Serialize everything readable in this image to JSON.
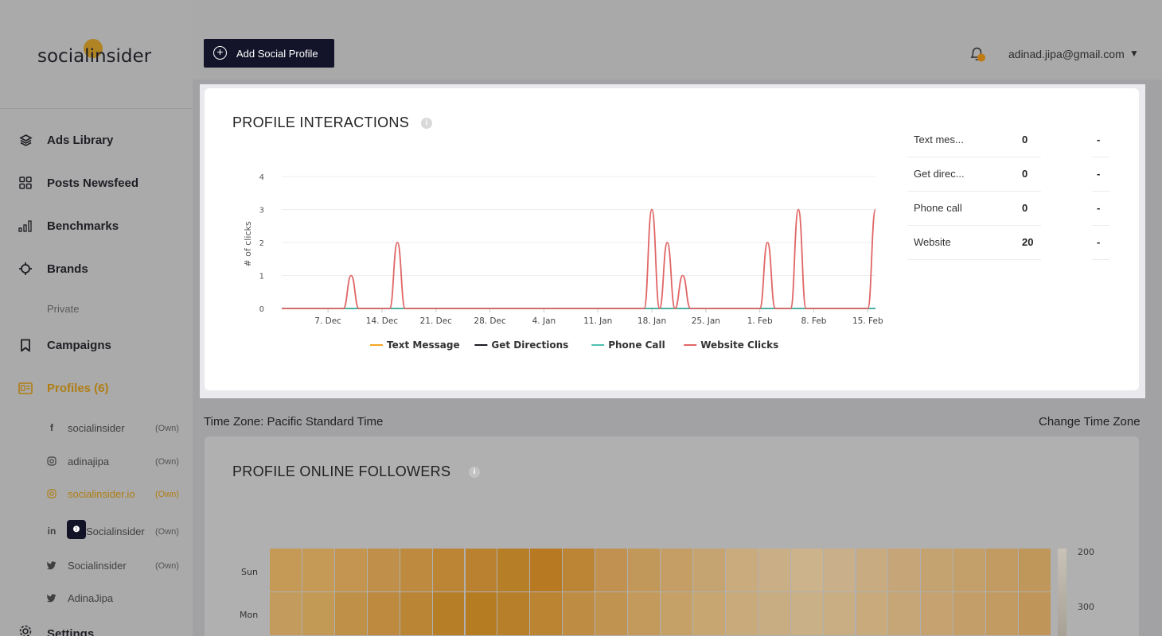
{
  "app": {
    "logo_text": "socialinsider"
  },
  "sidebar": {
    "items": [
      {
        "label": "Ads Library",
        "icon": "layers-icon"
      },
      {
        "label": "Posts Newsfeed",
        "icon": "grid-icon"
      },
      {
        "label": "Benchmarks",
        "icon": "bar-chart-icon"
      },
      {
        "label": "Brands",
        "icon": "crosshair-icon"
      },
      {
        "label": "Private"
      },
      {
        "label": "Campaigns",
        "icon": "bookmark-icon"
      },
      {
        "label": "Profiles (6)",
        "icon": "profile-card-icon"
      },
      {
        "label": "Settings",
        "icon": "gear-icon"
      }
    ],
    "profiles": [
      {
        "name": "socialinsider",
        "own": "(Own)",
        "network": "facebook"
      },
      {
        "name": "adinajipa",
        "own": "(Own)",
        "network": "instagram"
      },
      {
        "name": "socialinsider.io",
        "own": "(Own)",
        "network": "instagram"
      },
      {
        "name": "Socialinsider",
        "own": "(Own)",
        "network": "linkedin",
        "prefix": "in"
      },
      {
        "name": "Socialinsider",
        "own": "(Own)",
        "network": "twitter"
      },
      {
        "name": "AdinaJipa",
        "own": "",
        "network": "twitter"
      }
    ]
  },
  "topbar": {
    "add_profile_label": "Add Social Profile",
    "user_email": "adinad.jipa@gmail.com",
    "caret": "▼"
  },
  "interactions": {
    "title": "PROFILE INTERACTIONS",
    "info": "i",
    "summary": [
      {
        "name": "Text mes...",
        "value": "0",
        "change": "-"
      },
      {
        "name": "Get direc...",
        "value": "0",
        "change": "-"
      },
      {
        "name": "Phone call",
        "value": "0",
        "change": "-"
      },
      {
        "name": "Website",
        "value": "20",
        "change": "-"
      }
    ]
  },
  "timezone": {
    "label": "Time Zone: Pacific Standard Time",
    "change": "Change Time Zone"
  },
  "followers": {
    "title": "PROFILE ONLINE FOLLOWERS",
    "info": "i",
    "days": [
      "Sun",
      "Mon"
    ],
    "scale": [
      "200",
      "300"
    ]
  },
  "chart_data": [
    {
      "type": "line",
      "ylabel": "# of clicks",
      "ylim": [
        0,
        4
      ],
      "yticks": [
        0,
        1,
        2,
        3,
        4
      ],
      "x_tick_labels": [
        "7. Dec",
        "14. Dec",
        "21. Dec",
        "28. Dec",
        "4. Jan",
        "11. Jan",
        "18. Jan",
        "25. Jan",
        "1. Feb",
        "8. Feb",
        "15. Feb"
      ],
      "x": [
        "1. Dec",
        "2. Dec",
        "3. Dec",
        "4. Dec",
        "5. Dec",
        "6. Dec",
        "7. Dec",
        "8. Dec",
        "9. Dec",
        "10. Dec",
        "11. Dec",
        "12. Dec",
        "13. Dec",
        "14. Dec",
        "15. Dec",
        "16. Dec",
        "17. Dec",
        "18. Dec",
        "19. Dec",
        "20. Dec",
        "21. Dec",
        "22. Dec",
        "23. Dec",
        "24. Dec",
        "25. Dec",
        "26. Dec",
        "27. Dec",
        "28. Dec",
        "29. Dec",
        "30. Dec",
        "31. Dec",
        "1. Jan",
        "2. Jan",
        "3. Jan",
        "4. Jan",
        "5. Jan",
        "6. Jan",
        "7. Jan",
        "8. Jan",
        "9. Jan",
        "10. Jan",
        "11. Jan",
        "12. Jan",
        "13. Jan",
        "14. Jan",
        "15. Jan",
        "16. Jan",
        "17. Jan",
        "18. Jan",
        "19. Jan",
        "20. Jan",
        "21. Jan",
        "22. Jan",
        "23. Jan",
        "24. Jan",
        "25. Jan",
        "26. Jan",
        "27. Jan",
        "28. Jan",
        "29. Jan",
        "30. Jan",
        "31. Jan",
        "1. Feb",
        "2. Feb",
        "3. Feb",
        "4. Feb",
        "5. Feb",
        "6. Feb",
        "7. Feb",
        "8. Feb",
        "9. Feb",
        "10. Feb",
        "11. Feb",
        "12. Feb",
        "13. Feb",
        "14. Feb",
        "15. Feb",
        "16. Feb"
      ],
      "series": [
        {
          "name": "Text Message",
          "color": "#f5a623",
          "values": [
            0,
            0,
            0,
            0,
            0,
            0,
            0,
            0,
            0,
            0,
            0,
            0,
            0,
            0,
            0,
            0,
            0,
            0,
            0,
            0,
            0,
            0,
            0,
            0,
            0,
            0,
            0,
            0,
            0,
            0,
            0,
            0,
            0,
            0,
            0,
            0,
            0,
            0,
            0,
            0,
            0,
            0,
            0,
            0,
            0,
            0,
            0,
            0,
            0,
            0,
            0,
            0,
            0,
            0,
            0,
            0,
            0,
            0,
            0,
            0,
            0,
            0,
            0,
            0,
            0,
            0,
            0,
            0,
            0,
            0,
            0,
            0,
            0,
            0,
            0,
            0,
            0,
            0
          ]
        },
        {
          "name": "Get Directions",
          "color": "#1a1a24",
          "values": [
            0,
            0,
            0,
            0,
            0,
            0,
            0,
            0,
            0,
            0,
            0,
            0,
            0,
            0,
            0,
            0,
            0,
            0,
            0,
            0,
            0,
            0,
            0,
            0,
            0,
            0,
            0,
            0,
            0,
            0,
            0,
            0,
            0,
            0,
            0,
            0,
            0,
            0,
            0,
            0,
            0,
            0,
            0,
            0,
            0,
            0,
            0,
            0,
            0,
            0,
            0,
            0,
            0,
            0,
            0,
            0,
            0,
            0,
            0,
            0,
            0,
            0,
            0,
            0,
            0,
            0,
            0,
            0,
            0,
            0,
            0,
            0,
            0,
            0,
            0,
            0,
            0,
            0
          ]
        },
        {
          "name": "Phone Call",
          "color": "#4fc1b0",
          "values": [
            0,
            0,
            0,
            0,
            0,
            0,
            0,
            0,
            0,
            0,
            0,
            0,
            0,
            0,
            0,
            0,
            0,
            0,
            0,
            0,
            0,
            0,
            0,
            0,
            0,
            0,
            0,
            0,
            0,
            0,
            0,
            0,
            0,
            0,
            0,
            0,
            0,
            0,
            0,
            0,
            0,
            0,
            0,
            0,
            0,
            0,
            0,
            0,
            0,
            0,
            0,
            0,
            0,
            0,
            0,
            0,
            0,
            0,
            0,
            0,
            0,
            0,
            0,
            0,
            0,
            0,
            0,
            0,
            0,
            0,
            0,
            0,
            0,
            0,
            0,
            0,
            0,
            0
          ]
        },
        {
          "name": "Website Clicks",
          "color": "#e06666",
          "values": [
            0,
            0,
            0,
            0,
            0,
            0,
            0,
            0,
            0,
            1,
            0,
            0,
            0,
            0,
            0,
            2,
            0,
            0,
            0,
            0,
            0,
            0,
            0,
            0,
            0,
            0,
            0,
            0,
            0,
            0,
            0,
            0,
            0,
            0,
            0,
            0,
            0,
            0,
            0,
            0,
            0,
            0,
            0,
            0,
            0,
            0,
            0,
            0,
            3,
            0,
            2,
            0,
            1,
            0,
            0,
            0,
            0,
            0,
            0,
            0,
            0,
            0,
            0,
            2,
            0,
            0,
            0,
            3,
            0,
            0,
            0,
            0,
            0,
            0,
            0,
            0,
            0,
            3
          ]
        }
      ],
      "legend": "bottom-center",
      "grid": true
    },
    {
      "type": "heatmap",
      "rows": [
        "Sun",
        "Mon"
      ],
      "scale_labels": [
        "200",
        "300"
      ]
    }
  ]
}
